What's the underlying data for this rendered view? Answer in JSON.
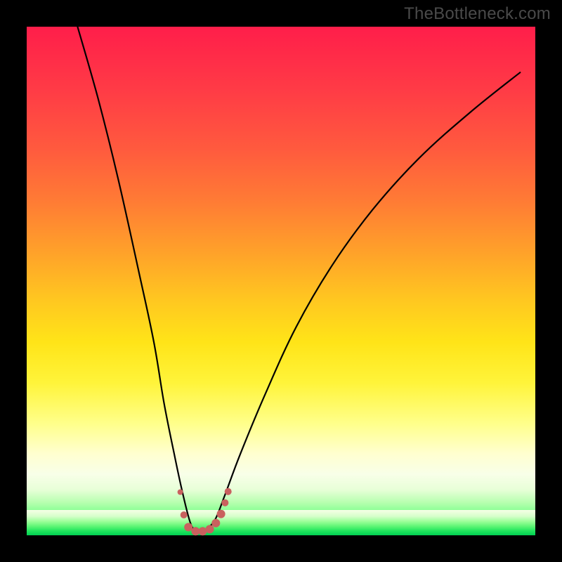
{
  "watermark": {
    "text": "TheBottleneck.com"
  },
  "colors": {
    "background": "#000000",
    "curve": "#000000",
    "marker": "#c9615f",
    "gradient_top": "#ff1e4a",
    "gradient_bottom": "#00d052"
  },
  "chart_data": {
    "type": "line",
    "title": "",
    "xlabel": "",
    "ylabel": "",
    "xlim": [
      0,
      100
    ],
    "ylim": [
      0,
      100
    ],
    "grid": false,
    "legend": false,
    "annotations": [],
    "series": [
      {
        "name": "bottleneck-curve",
        "x": [
          10,
          14,
          18,
          22,
          25,
          27,
          29,
          30.5,
          32,
          33,
          34,
          35,
          37,
          39,
          42,
          47,
          53,
          60,
          68,
          77,
          87,
          97
        ],
        "y": [
          100,
          86,
          70,
          52,
          38,
          26,
          16,
          9,
          3,
          1,
          0.5,
          1,
          3,
          8,
          16,
          28,
          41,
          53,
          64,
          74,
          83,
          91
        ]
      }
    ],
    "markers": {
      "name": "highlight-dots",
      "color": "#c9615f",
      "points": [
        {
          "x": 30.2,
          "y": 8.5,
          "r": 4
        },
        {
          "x": 30.9,
          "y": 4.0,
          "r": 5
        },
        {
          "x": 31.8,
          "y": 1.6,
          "r": 6
        },
        {
          "x": 33.2,
          "y": 0.8,
          "r": 6
        },
        {
          "x": 34.6,
          "y": 0.8,
          "r": 6
        },
        {
          "x": 36.0,
          "y": 1.2,
          "r": 6
        },
        {
          "x": 37.2,
          "y": 2.4,
          "r": 6
        },
        {
          "x": 38.2,
          "y": 4.2,
          "r": 6
        },
        {
          "x": 39.0,
          "y": 6.4,
          "r": 5
        },
        {
          "x": 39.6,
          "y": 8.6,
          "r": 5
        }
      ]
    }
  }
}
